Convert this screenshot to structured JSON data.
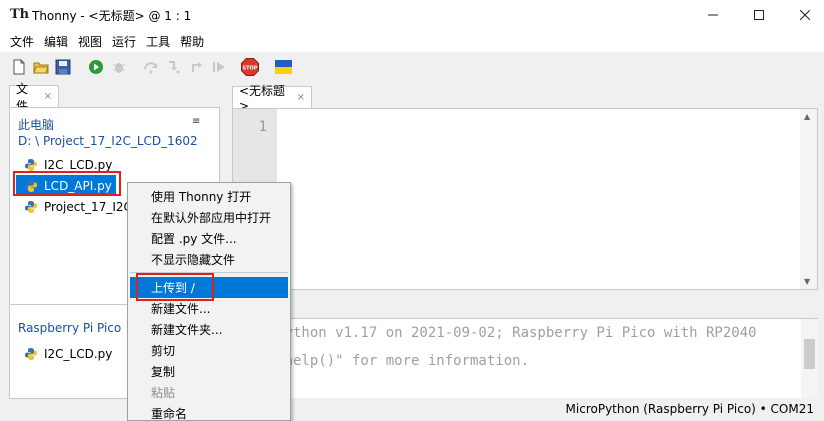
{
  "window": {
    "title": "Thonny  -  <无标题>  @  1 : 1",
    "minimize": "—",
    "maximize": "☐",
    "close": "✕"
  },
  "menubar": [
    "文件",
    "编辑",
    "视图",
    "运行",
    "工具",
    "帮助"
  ],
  "toolbar_icons": [
    "new-file-icon",
    "open-file-icon",
    "save-icon",
    "run-icon",
    "debug-icon",
    "step-over-icon",
    "step-into-icon",
    "step-out-icon",
    "resume-icon",
    "stop-icon",
    "ukraine-flag-icon"
  ],
  "stop_label": "STOP",
  "files_panel": {
    "tab_label": "文件",
    "tab_close": "×",
    "this_computer": "此电脑",
    "path": "D: \\ Project_17_I2C_LCD_1602",
    "menu_glyph": "≡",
    "local_files": [
      "I2C_LCD.py",
      "LCD_API.py",
      "Project_17_I2C_LCD_1602.py"
    ],
    "device_title": "Raspberry Pi Pico",
    "device_files": [
      "I2C_LCD.py"
    ]
  },
  "editor": {
    "tab_label": "<无标题>",
    "tab_close": "×",
    "line_numbers": [
      "1"
    ]
  },
  "shell": {
    "lines": [
      "MicroPython v1.17 on 2021-09-02; Raspberry Pi Pico with RP2040",
      "Type \"help()\" for more information."
    ]
  },
  "status": "MicroPython (Raspberry Pi Pico)  •  COM21",
  "context_menu": {
    "items": [
      {
        "label": "使用 Thonny 打开",
        "state": "normal"
      },
      {
        "label": "在默认外部应用中打开",
        "state": "normal"
      },
      {
        "label": "配置 .py 文件...",
        "state": "normal"
      },
      {
        "label": "不显示隐藏文件",
        "state": "normal"
      },
      {
        "label": "上传到 /",
        "state": "active"
      },
      {
        "label": "新建文件...",
        "state": "normal"
      },
      {
        "label": "新建文件夹...",
        "state": "normal"
      },
      {
        "label": "剪切",
        "state": "normal"
      },
      {
        "label": "复制",
        "state": "normal"
      },
      {
        "label": "粘贴",
        "state": "disabled"
      },
      {
        "label": "重命名",
        "state": "normal"
      }
    ]
  },
  "colors": {
    "selection": "#0078d7",
    "highlight_box": "#e02020",
    "section_title": "#1a4fa3"
  }
}
